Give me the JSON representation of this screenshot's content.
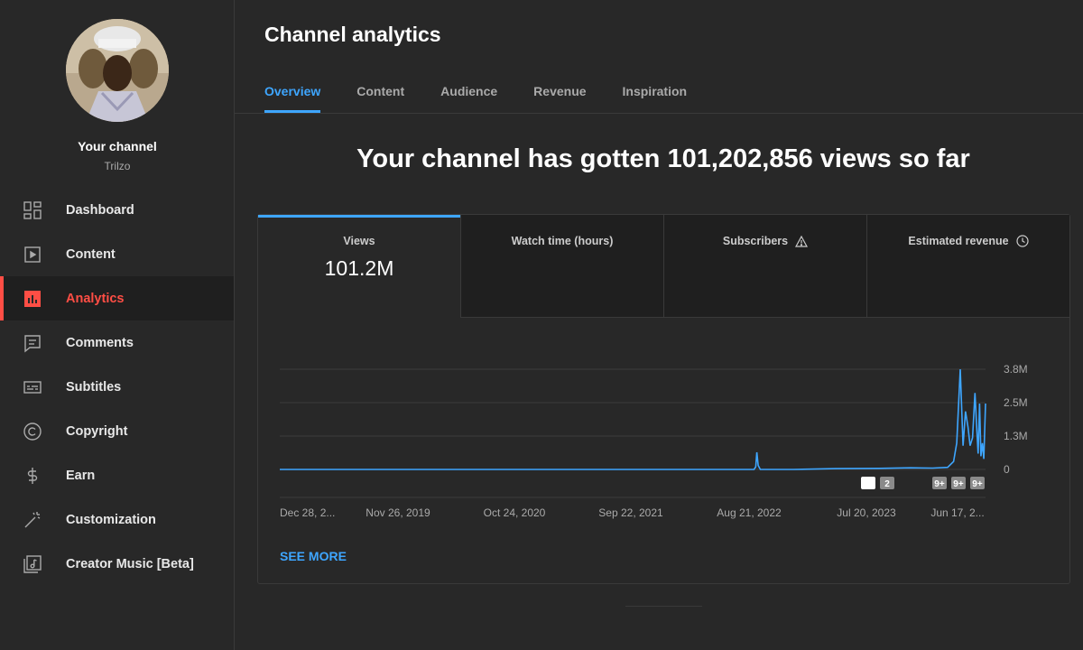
{
  "channel": {
    "name": "Your channel",
    "handle": "Trilzo"
  },
  "sidebar": {
    "items": [
      {
        "label": "Dashboard",
        "icon": "dashboard-icon"
      },
      {
        "label": "Content",
        "icon": "content-icon"
      },
      {
        "label": "Analytics",
        "icon": "analytics-icon",
        "active": true
      },
      {
        "label": "Comments",
        "icon": "comments-icon"
      },
      {
        "label": "Subtitles",
        "icon": "subtitles-icon"
      },
      {
        "label": "Copyright",
        "icon": "copyright-icon"
      },
      {
        "label": "Earn",
        "icon": "dollar-icon"
      },
      {
        "label": "Customization",
        "icon": "magic-wand-icon"
      },
      {
        "label": "Creator Music [Beta]",
        "icon": "music-icon"
      }
    ]
  },
  "page": {
    "title": "Channel analytics"
  },
  "tabs": [
    "Overview",
    "Content",
    "Audience",
    "Revenue",
    "Inspiration"
  ],
  "active_tab": "Overview",
  "headline": "Your channel has gotten 101,202,856 views so far",
  "metrics": [
    {
      "label": "Views",
      "value": "101.2M"
    },
    {
      "label": "Watch time (hours)",
      "value": ""
    },
    {
      "label": "Subscribers",
      "value": "",
      "icon": "warning-icon"
    },
    {
      "label": "Estimated revenue",
      "value": "",
      "icon": "clock-icon"
    }
  ],
  "see_more": "SEE MORE",
  "colors": {
    "accent_blue": "#3ea6ff",
    "active_red": "#ff4e45",
    "line": "#3ea6ff"
  },
  "chart_data": {
    "type": "line",
    "x_ticks": [
      "Dec 28, 2...",
      "Nov 26, 2019",
      "Oct 24, 2020",
      "Sep 22, 2021",
      "Aug 21, 2022",
      "Jul 20, 2023",
      "Jun 17, 2..."
    ],
    "y_ticks": [
      "3.8M",
      "2.5M",
      "1.3M",
      "0"
    ],
    "ylim": [
      0,
      3800000
    ],
    "grid": true,
    "series": [
      {
        "x": [
          "2018-12-28",
          "2019-06-01",
          "2020-01-01",
          "2021-01-01",
          "2022-01-01",
          "2022-09-10",
          "2022-09-15",
          "2022-09-18",
          "2022-09-22",
          "2022-09-28",
          "2023-01-01",
          "2023-05-01",
          "2023-09-01",
          "2023-12-01",
          "2024-02-01",
          "2024-03-15",
          "2024-04-01",
          "2024-04-10",
          "2024-04-20",
          "2024-04-28",
          "2024-05-05",
          "2024-05-12",
          "2024-05-18",
          "2024-05-25",
          "2024-06-01",
          "2024-06-05",
          "2024-06-10",
          "2024-06-14",
          "2024-06-18",
          "2024-06-22",
          "2024-06-26",
          "2024-07-01"
        ],
        "values": [
          0,
          0,
          0,
          0,
          0,
          0,
          100000,
          650000,
          150000,
          0,
          0,
          30000,
          40000,
          60000,
          50000,
          80000,
          300000,
          1000000,
          3800000,
          900000,
          2200000,
          1600000,
          900000,
          1200000,
          2900000,
          1800000,
          600000,
          2500000,
          500000,
          1000000,
          400000,
          2500000
        ]
      }
    ],
    "markers": [
      "",
      "2",
      "9+",
      "9+",
      "9+"
    ]
  }
}
